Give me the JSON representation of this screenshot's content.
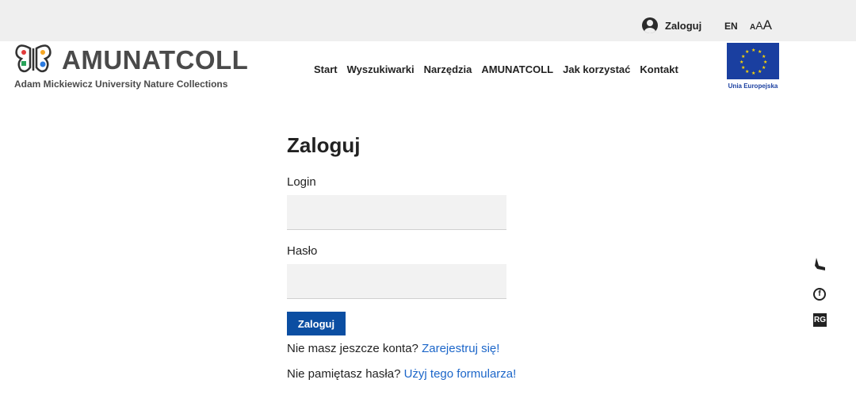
{
  "topbar": {
    "login_label": "Zaloguj",
    "lang": "EN",
    "font_size_small": "A",
    "font_size_medium": "A",
    "font_size_large": "A"
  },
  "logo": {
    "title": "AMUNATCOLL",
    "subtitle": "Adam Mickiewicz University Nature Collections"
  },
  "nav": {
    "items": [
      "Start",
      "Wyszukiwarki",
      "Narzędzia",
      "AMUNATCOLL",
      "Jak korzystać",
      "Kontakt"
    ]
  },
  "eu": {
    "label": "Unia Europejska"
  },
  "form": {
    "heading": "Zaloguj",
    "login_label": "Login",
    "login_value": "",
    "password_label": "Hasło",
    "password_value": "",
    "submit_label": "Zaloguj",
    "register_text": "Nie masz jeszcze konta?",
    "register_link": "Zarejestruj się!",
    "forgot_text": "Nie pamiętasz hasła?",
    "forgot_link": "Użyj tego formularza!"
  },
  "side": {
    "icons": [
      "orcid-icon",
      "facebook-icon",
      "researchgate-icon"
    ],
    "rg_label": "RG",
    "fb_label": "f"
  },
  "colors": {
    "primary": "#0b4ea2",
    "link": "#1c66c9",
    "topbar_bg": "#efefef",
    "eu_blue": "#1a3fa0"
  }
}
